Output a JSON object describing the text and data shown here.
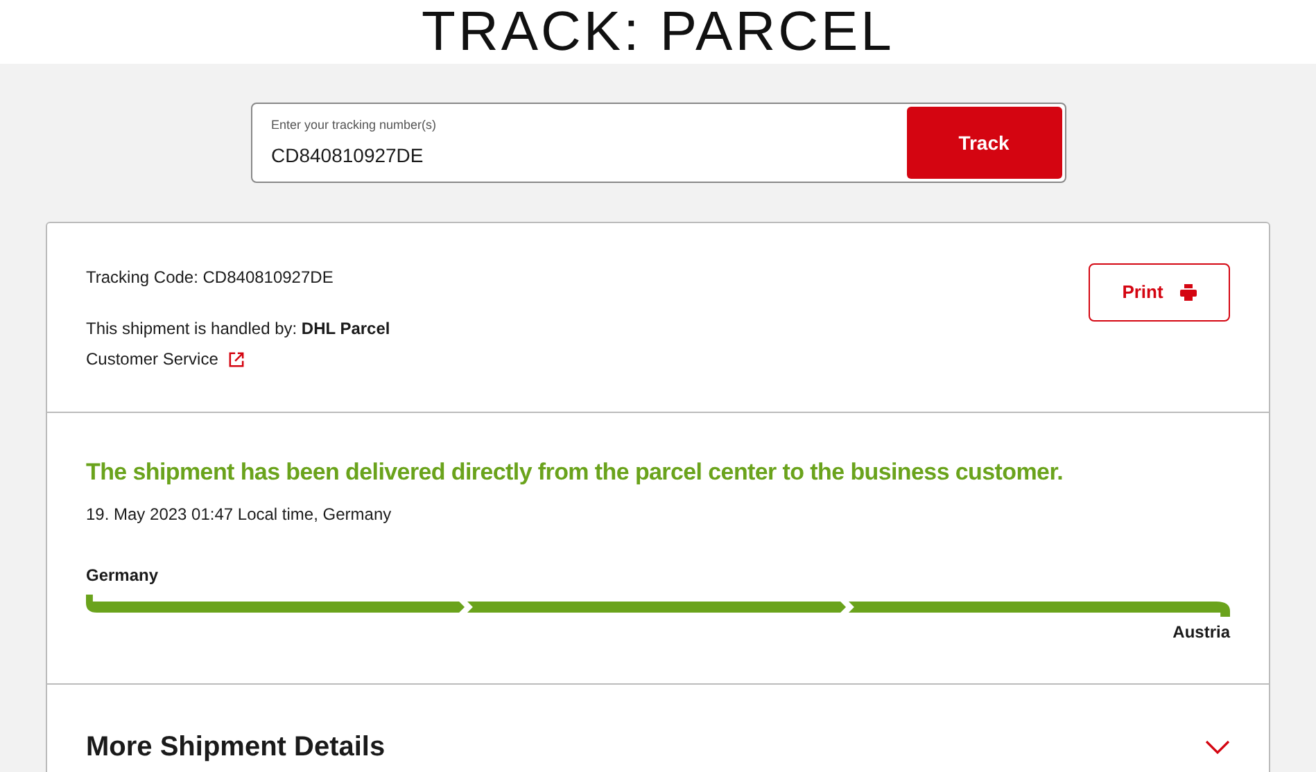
{
  "page_title": "TRACK: PARCEL",
  "search": {
    "label": "Enter your tracking number(s)",
    "value": "CD840810927DE",
    "button": "Track"
  },
  "shipment": {
    "tracking_code": "Tracking Code: CD840810927DE",
    "handled_by": "This shipment is handled by: **DHL Parcel**",
    "customer_service": "Customer Service",
    "print_button": "Print"
  },
  "status": {
    "headline": "The shipment has been delivered directly from the parcel center to the business customer.",
    "timestamp": "19. May 2023 01:47 Local time, Germany",
    "origin": "Germany",
    "destination": "Austria",
    "segments": [
      {
        "done": true
      },
      {
        "done": true
      },
      {
        "done": true
      }
    ]
  },
  "details": {
    "title": "More Shipment Details",
    "expanded": false
  }
}
